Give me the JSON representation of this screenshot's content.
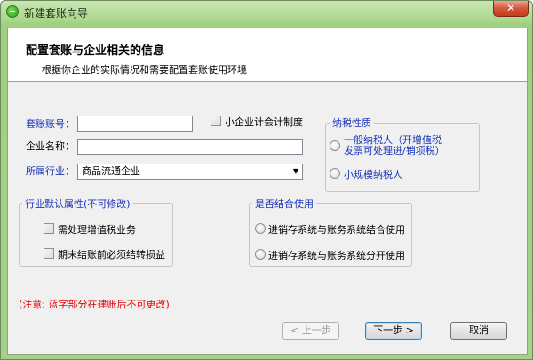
{
  "window": {
    "title": "新建套账向导",
    "close_glyph": "✕"
  },
  "header": {
    "title": "配置套账与企业相关的信息",
    "subtitle": "根据你企业的实际情况和需要配置套账使用环境"
  },
  "form": {
    "account_no_label": "套账账号：",
    "account_no_value": "",
    "small_enterprise_label": "小企业计会计制度",
    "company_name_label": "企业名称：",
    "company_name_value": "",
    "industry_label": "所属行业：",
    "industry_value": "商品流通企业"
  },
  "taxpayer": {
    "title": "纳税性质",
    "general_line1": "一般纳税人（开增值税",
    "general_line2": "发票可处理进/销项税）",
    "small_scale": "小规模纳税人"
  },
  "industry_defaults": {
    "title": "行业默认属性(不可修改)",
    "vat_business": "需处理增值税业务",
    "period_end_transfer": "期末结账前必须结转损益"
  },
  "combine": {
    "title": "是否结合使用",
    "combined": "进销存系统与账务系统结合使用",
    "separate": "进销存系统与账务系统分开使用"
  },
  "note": "(注意: 蓝字部分在建账后不可更改)",
  "buttons": {
    "prev": "< 上一步",
    "next": "下一步 >",
    "cancel": "取消"
  },
  "colors": {
    "locked_label": "#1c34b8",
    "note": "#e00000",
    "title_bar": "#a6d18a"
  }
}
